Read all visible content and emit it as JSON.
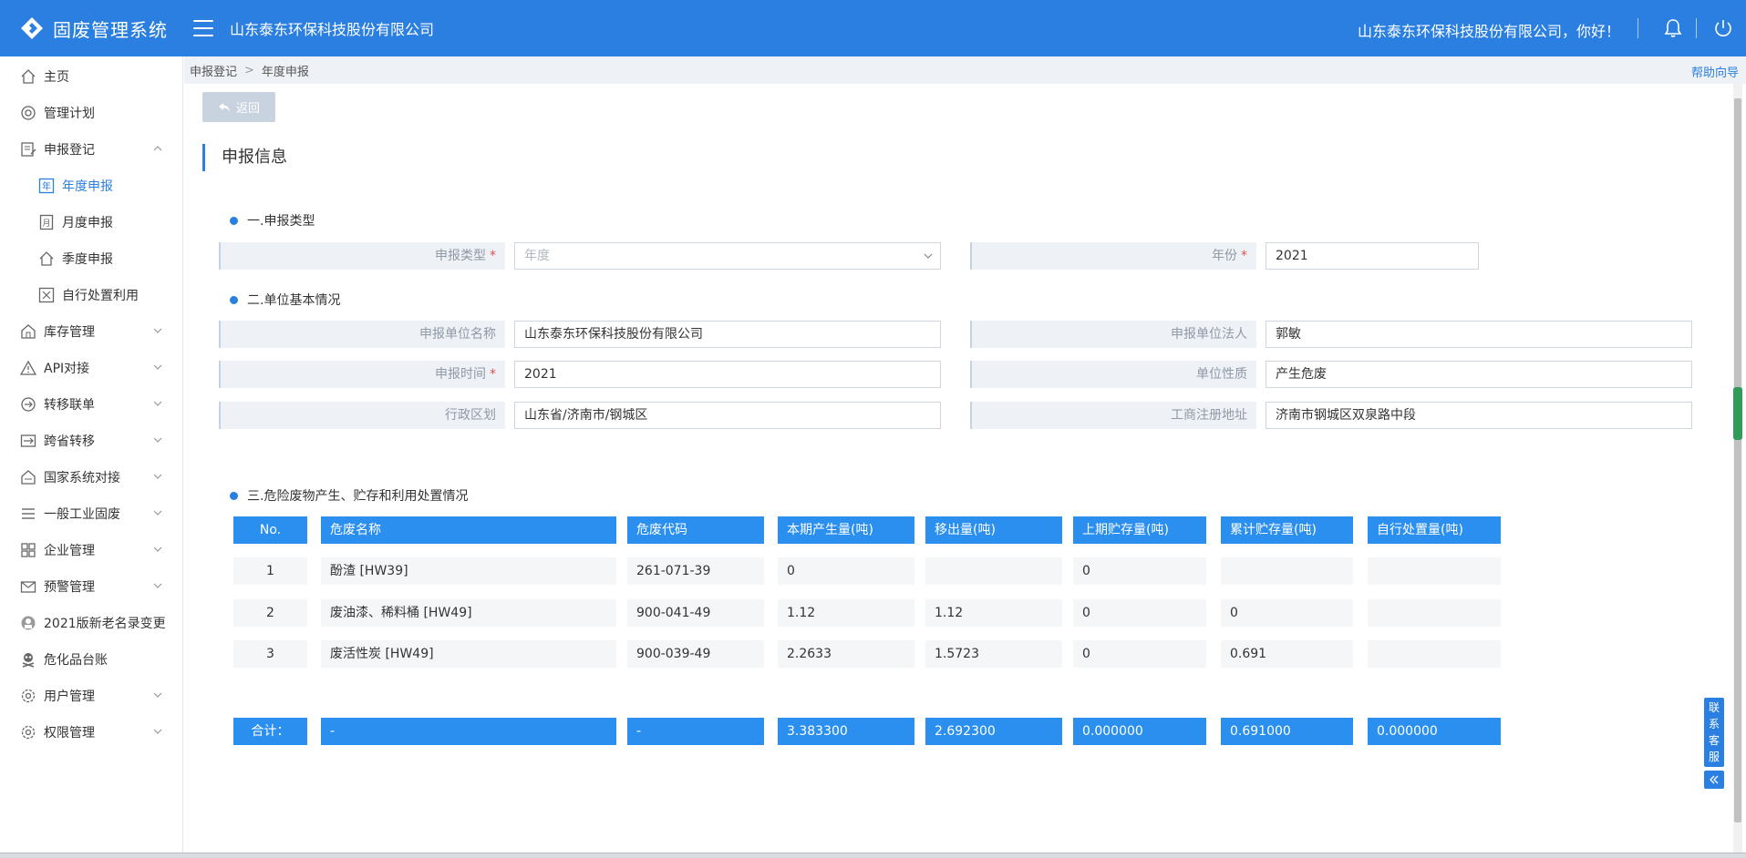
{
  "app": {
    "title": "固废管理系统",
    "company": "山东泰东环保科技股份有限公司",
    "greeting": "山东泰东环保科技股份有限公司，你好！"
  },
  "sidebar": {
    "items": [
      {
        "label": "主页",
        "icon": "home-icon"
      },
      {
        "label": "管理计划",
        "icon": "plan-icon"
      },
      {
        "label": "申报登记",
        "icon": "register-icon"
      },
      {
        "label": "年度申报",
        "icon": "year-icon"
      },
      {
        "label": "月度申报",
        "icon": "month-icon"
      },
      {
        "label": "季度申报",
        "icon": "quarter-icon"
      },
      {
        "label": "自行处置利用",
        "icon": "disposal-icon"
      },
      {
        "label": "库存管理",
        "icon": "inventory-icon"
      },
      {
        "label": "API对接",
        "icon": "warning-icon"
      },
      {
        "label": "转移联单",
        "icon": "transfer-icon"
      },
      {
        "label": "跨省转移",
        "icon": "cross-province-icon"
      },
      {
        "label": "国家系统对接",
        "icon": "national-icon"
      },
      {
        "label": "一般工业固废",
        "icon": "list-icon"
      },
      {
        "label": "企业管理",
        "icon": "grid-icon"
      },
      {
        "label": "预警管理",
        "icon": "mail-icon"
      },
      {
        "label": "2021版新老名录变更",
        "icon": "change-icon"
      },
      {
        "label": "危化品台账",
        "icon": "hazard-icon"
      },
      {
        "label": "用户管理",
        "icon": "user-gear-icon"
      },
      {
        "label": "权限管理",
        "icon": "permission-gear-icon"
      }
    ]
  },
  "breadcrumb": {
    "parent": "申报登记",
    "current": "年度申报",
    "help": "帮助向导"
  },
  "back_label": "返回",
  "section_title": "申报信息",
  "sections": {
    "s1": "一.申报类型",
    "s2": "二.单位基本情况",
    "s3": "三.危险废物产生、贮存和利用处置情况"
  },
  "form": {
    "report_type_label": "申报类型",
    "report_type_value": "年度",
    "year_label": "年份",
    "year_value": "2021",
    "unit_name_label": "申报单位名称",
    "unit_name_value": "山东泰东环保科技股份有限公司",
    "legal_person_label": "申报单位法人",
    "legal_person_value": "郭敏",
    "report_time_label": "申报时间",
    "report_time_value": "2021",
    "unit_nature_label": "单位性质",
    "unit_nature_value": "产生危废",
    "region_label": "行政区划",
    "region_value": "山东省/济南市/钢城区",
    "address_label": "工商注册地址",
    "address_value": "济南市钢城区双泉路中段",
    "required_mark": "*"
  },
  "table": {
    "headers": [
      "No.",
      "危废名称",
      "危废代码",
      "本期产生量(吨)",
      "移出量(吨)",
      "上期贮存量(吨)",
      "累计贮存量(吨)",
      "自行处置量(吨)"
    ],
    "rows": [
      [
        "1",
        "酚渣 [HW39]",
        "261-071-39",
        "0",
        "",
        "0",
        "",
        ""
      ],
      [
        "2",
        "废油漆、稀料桶 [HW49]",
        "900-041-49",
        "1.12",
        "1.12",
        "0",
        "0",
        ""
      ],
      [
        "3",
        "废活性炭 [HW49]",
        "900-039-49",
        "2.2633",
        "1.5723",
        "0",
        "0.691",
        ""
      ]
    ],
    "footer": [
      "合计：",
      "-",
      "-",
      "3.383300",
      "2.692300",
      "0.000000",
      "0.691000",
      "0.000000"
    ]
  },
  "service": {
    "label": "联系客服"
  },
  "colors": {
    "primary": "#2b7fe0",
    "table_header": "#2b8ff0"
  }
}
